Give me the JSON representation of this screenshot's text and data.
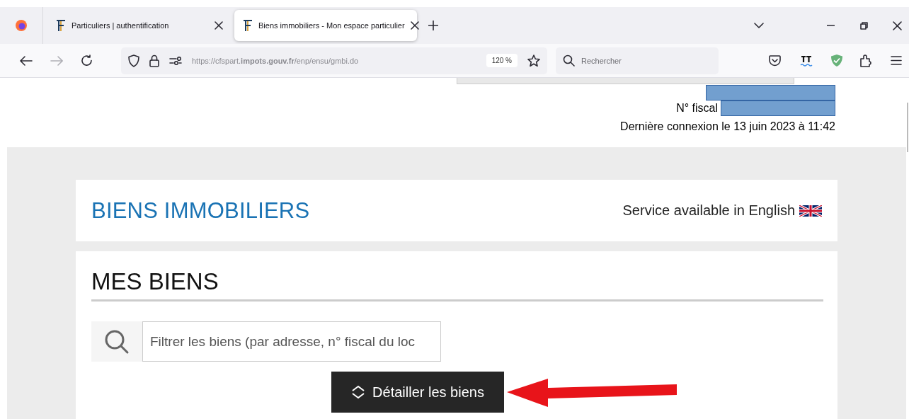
{
  "browser": {
    "tabs": [
      {
        "title": "Particuliers | authentification",
        "selected": false
      },
      {
        "title": "Biens immobiliers - Mon espace particulier",
        "selected": true
      }
    ],
    "url": "https://cfspart.**impots.gouv.fr**/enp/ensu/gmbi.do",
    "zoom": "120 %",
    "search": {
      "placeholder": "Rechercher"
    }
  },
  "header": {
    "fiscal_label": "N° fiscal",
    "last_login": "Dernière connexion le 13 juin 2023 à 11:42"
  },
  "page": {
    "title": "BIENS IMMOBILIERS",
    "language_link": "Service available in English"
  },
  "section": {
    "title": "MES BIENS",
    "filter": {
      "placeholder": "Filtrer les biens (par adresse, n° fiscal du loc"
    },
    "button": "Détailler les biens"
  }
}
